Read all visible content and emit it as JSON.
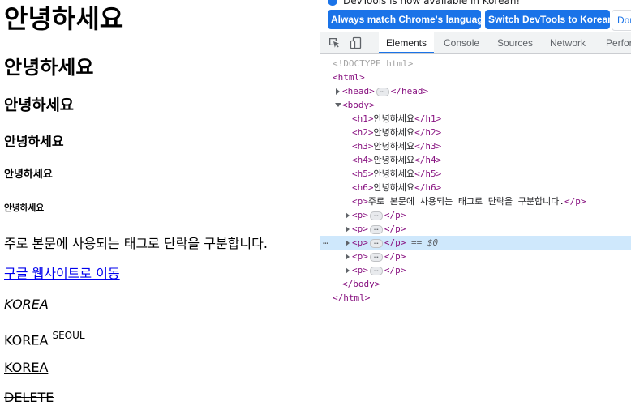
{
  "page": {
    "h1": "안녕하세요",
    "h2": "안녕하세요",
    "h3": "안녕하세요",
    "h4": "안녕하세요",
    "h5": "안녕하세요",
    "h6": "안녕하세요",
    "paragraph": "주로 본문에 사용되는 태그로 단락을 구분합니다.",
    "link": "구글 웹사이트로 이동",
    "italic": "KOREA",
    "sup_base": "KOREA",
    "sup_text": "SEOUL",
    "underline": "KOREA",
    "strike": "DELETE"
  },
  "devtools": {
    "infobar": {
      "message": "DevTools is now available in Korean!",
      "match_button": "Always match Chrome's language",
      "switch_button": "Switch DevTools to Korean",
      "dont_button": "Don't show again"
    },
    "tabs": [
      "Elements",
      "Console",
      "Sources",
      "Network",
      "Performance"
    ],
    "tree": {
      "doctype": "<!DOCTYPE html>",
      "html_open": "<html>",
      "head_open": "<head>",
      "head_close": "</head>",
      "body_open": "<body>",
      "h1_open": "<h1>",
      "h1_text": "안녕하세요",
      "h1_close": "</h1>",
      "h2_open": "<h2>",
      "h2_text": "안녕하세요",
      "h2_close": "</h2>",
      "h3_open": "<h3>",
      "h3_text": "안녕하세요",
      "h3_close": "</h3>",
      "h4_open": "<h4>",
      "h4_text": "안녕하세요",
      "h4_close": "</h4>",
      "h5_open": "<h5>",
      "h5_text": "안녕하세요",
      "h5_close": "</h5>",
      "h6_open": "<h6>",
      "h6_text": "안녕하세요",
      "h6_close": "</h6>",
      "p_open": "<p>",
      "p_text": "주로 본문에 사용되는 태그로 단락을 구분합니다.",
      "p_close": "</p>",
      "ellipsis": "…",
      "selected_marker": "== $0",
      "row_dots": "…",
      "body_close": "</body>",
      "html_close": "</html>"
    }
  },
  "colors": {
    "accent": "#1a73e8",
    "tag": "#881280",
    "selection": "#cfe8fc",
    "link": "#0000ee"
  }
}
